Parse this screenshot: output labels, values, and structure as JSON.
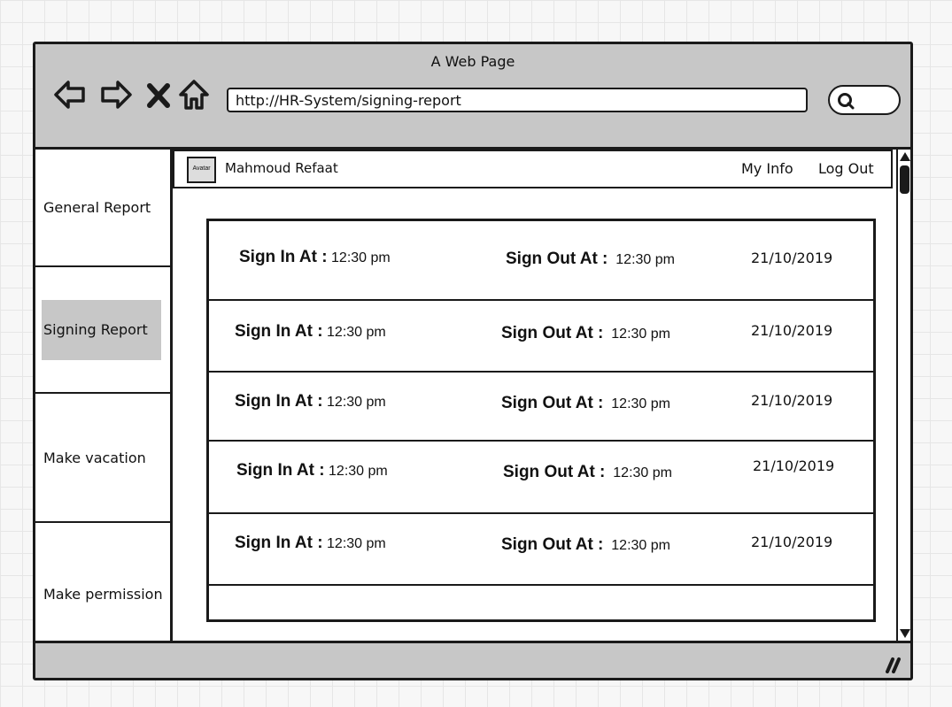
{
  "window": {
    "title": "A Web Page"
  },
  "browser": {
    "url": "http://HR-System/signing-report"
  },
  "sidebar": {
    "items": [
      {
        "label": "General  Report",
        "active": false
      },
      {
        "label": "Signing Report",
        "active": true
      },
      {
        "label": "Make vacation",
        "active": false
      },
      {
        "label": "Make permission",
        "active": false
      }
    ]
  },
  "header": {
    "avatar_label": "Avatar",
    "user_name": "Mahmoud Refaat",
    "my_info": "My Info",
    "log_out": "Log Out"
  },
  "report": {
    "sign_in_label": "Sign In At :",
    "sign_out_label": "Sign Out At :",
    "rows": [
      {
        "sign_in": "12:30 pm",
        "sign_out": "12:30 pm",
        "date": "21/10/2019"
      },
      {
        "sign_in": "12:30 pm",
        "sign_out": "12:30 pm",
        "date": "21/10/2019"
      },
      {
        "sign_in": "12:30 pm",
        "sign_out": "12:30 pm",
        "date": "21/10/2019"
      },
      {
        "sign_in": "12:30 pm",
        "sign_out": "12:30 pm",
        "date": "21/10/2019"
      },
      {
        "sign_in": "12:30 pm",
        "sign_out": "12:30 pm",
        "date": "21/10/2019"
      }
    ]
  },
  "colors": {
    "chrome": "#c7c7c7",
    "active_item": "#c7c7c7",
    "stroke": "#1a1a1a"
  }
}
